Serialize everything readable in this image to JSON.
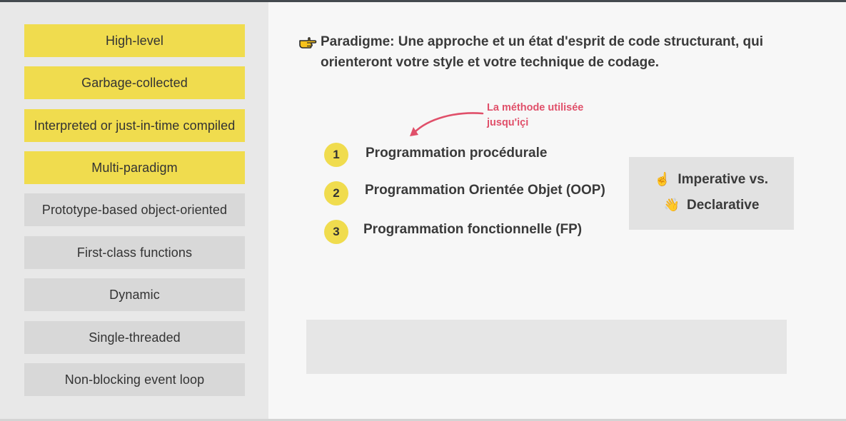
{
  "sidebar": {
    "items": [
      {
        "label": "High-level",
        "style": "yellow"
      },
      {
        "label": "Garbage-collected",
        "style": "yellow"
      },
      {
        "label": "Interpreted or just-in-time compiled",
        "style": "yellow"
      },
      {
        "label": "Multi-paradigm",
        "style": "yellow"
      },
      {
        "label": "Prototype-based object-oriented",
        "style": "grey"
      },
      {
        "label": "First-class functions",
        "style": "grey"
      },
      {
        "label": "Dynamic",
        "style": "grey"
      },
      {
        "label": "Single-threaded",
        "style": "grey"
      },
      {
        "label": "Non-blocking event loop",
        "style": "grey"
      }
    ]
  },
  "main": {
    "paradigm_icon": "pointing-hand-icon",
    "paradigm_text": "Paradigme: Une approche et un état d'esprit de code structurant, qui orienteront votre style et votre technique de codage.",
    "annotation": {
      "line1": "La méthode utilisée",
      "line2": "jusqu'içi"
    },
    "paradigms": [
      {
        "number": "1",
        "label": "Programmation procédurale"
      },
      {
        "number": "2",
        "label": "Programmation Orientée Objet (OOP)"
      },
      {
        "number": "3",
        "label": "Programmation fonctionnelle (FP)"
      }
    ],
    "imperative_box": {
      "line1_icon": "pointing-up-emoji",
      "line1": "Imperative vs.",
      "line2_icon": "waving-hand-emoji",
      "line2": "Declarative"
    }
  },
  "colors": {
    "accent_yellow": "#f0dc4e",
    "annotation_red": "#e0506a",
    "pill_grey": "#d8d8d8",
    "sidebar_bg": "#e8e8e8"
  }
}
